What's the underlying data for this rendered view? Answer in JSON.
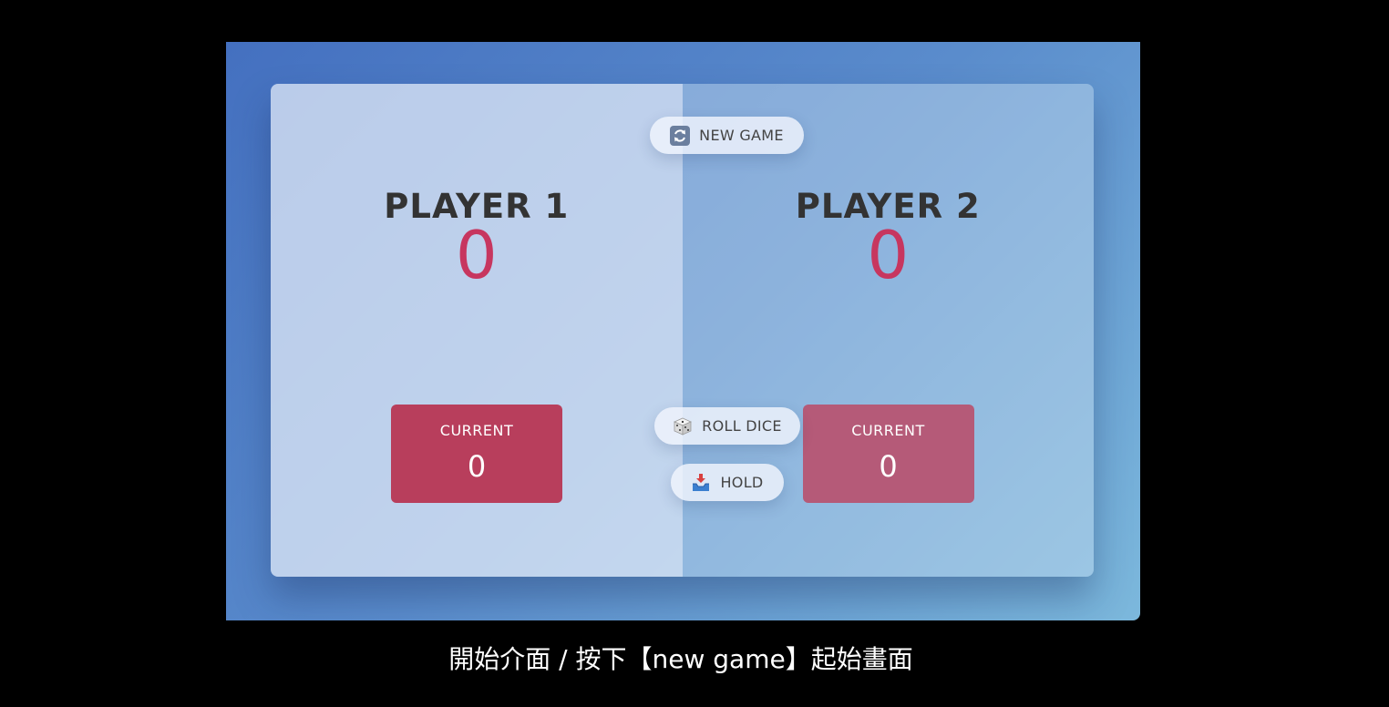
{
  "game": {
    "new_game_label": "NEW GAME",
    "roll_dice_label": "ROLL DICE",
    "hold_label": "HOLD",
    "players": [
      {
        "name": "PLAYER 1",
        "score": "0",
        "current_label": "CURRENT",
        "current_score": "0"
      },
      {
        "name": "PLAYER 2",
        "score": "0",
        "current_label": "CURRENT",
        "current_score": "0"
      }
    ]
  },
  "icons": {
    "new_game": "refresh-icon",
    "roll_dice": "dice-icon",
    "hold": "inbox-tray-icon"
  },
  "caption": "開始介面 / 按下【new game】起始畫面",
  "colors": {
    "score": "#c7365f",
    "current_active": "#b83e5c",
    "current_inactive": "#b55a78",
    "background_start": "#4470c0",
    "background_end": "#7cb8dc"
  }
}
